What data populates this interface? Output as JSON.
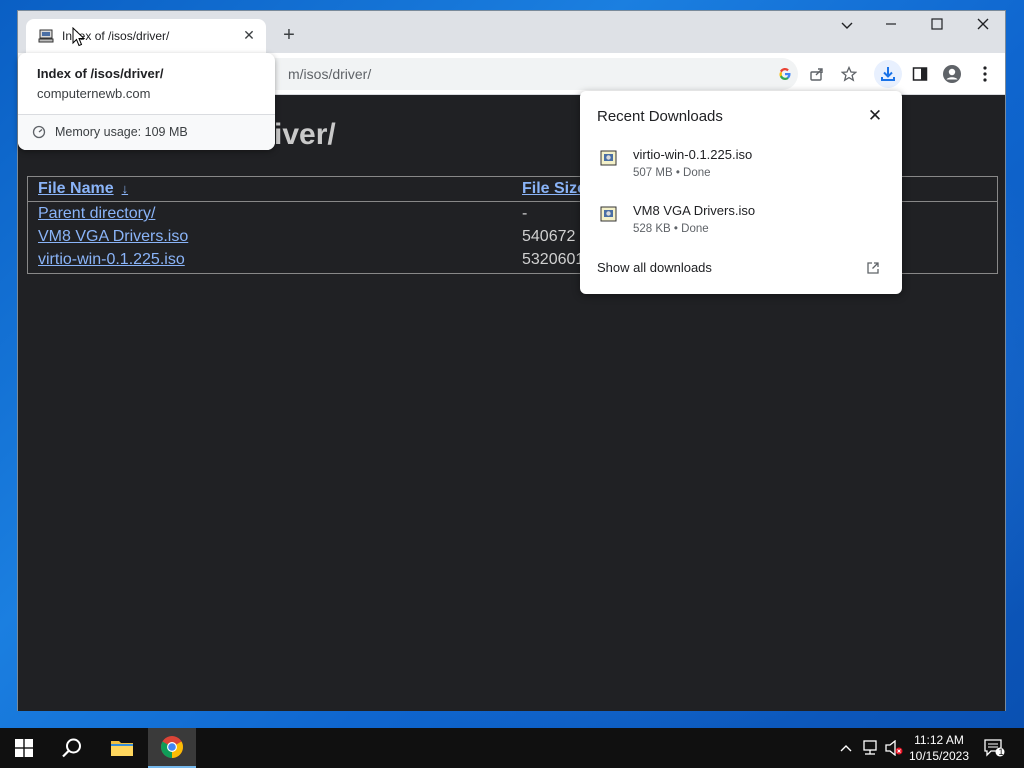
{
  "browser": {
    "tab": {
      "title": "Index of /isos/driver/"
    },
    "omnibox": {
      "url_visible": "m/isos/driver/"
    }
  },
  "hovercard": {
    "title": "Index of /isos/driver/",
    "domain": "computernewb.com",
    "memory": "Memory usage: 109 MB"
  },
  "page": {
    "heading_visible": "iver/",
    "columns": {
      "name": "File Name",
      "name_sort_arrow": "↓",
      "size": "File Size"
    },
    "rows": [
      {
        "name": "Parent directory/",
        "size": "-"
      },
      {
        "name": "VM8 VGA Drivers.iso",
        "size": "540672"
      },
      {
        "name": "virtio-win-0.1.225.iso",
        "size": "5320601"
      }
    ]
  },
  "downloads": {
    "title": "Recent Downloads",
    "items": [
      {
        "name": "virtio-win-0.1.225.iso",
        "meta": "507 MB • Done"
      },
      {
        "name": "VM8 VGA Drivers.iso",
        "meta": "528 KB • Done"
      }
    ],
    "show_all": "Show all downloads"
  },
  "taskbar": {
    "time": "11:12 AM",
    "date": "10/15/2023",
    "notification_count": "1"
  },
  "icons": {
    "favicon": "computer-icon",
    "download": "download-icon",
    "iso_file": "iso-file-icon"
  },
  "colors": {
    "link": "#8ab4f8",
    "download_active": "#1a73e8",
    "desktop": "#1b7fe0"
  }
}
